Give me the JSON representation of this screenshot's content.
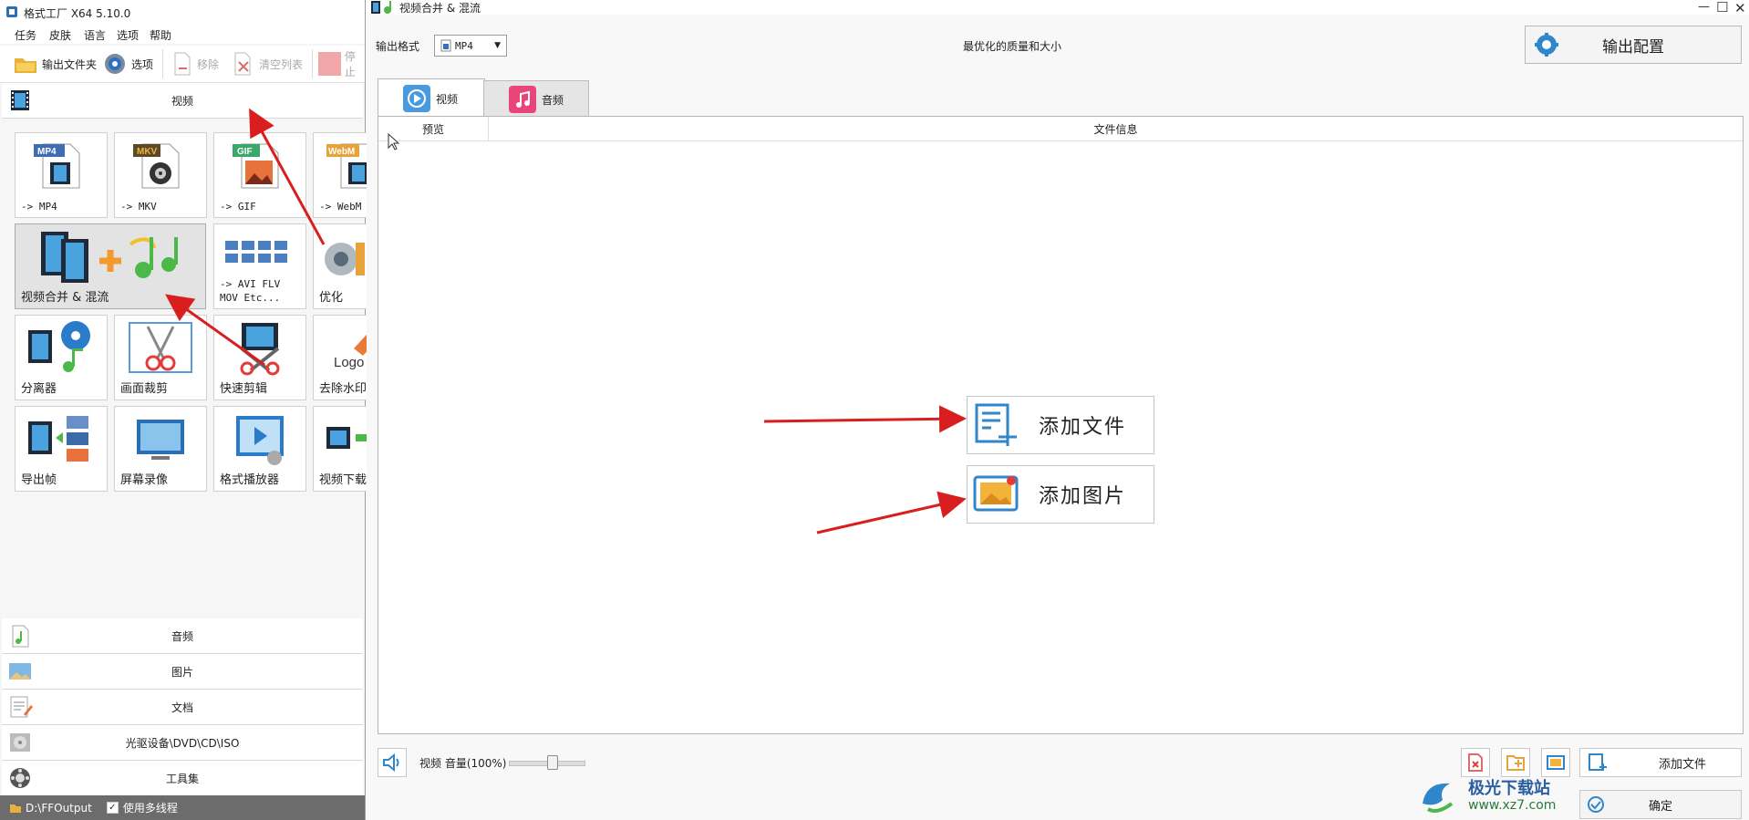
{
  "main_window": {
    "title": "格式工厂 X64 5.10.0",
    "menu": [
      "任务",
      "皮肤",
      "语言",
      "选项",
      "帮助"
    ],
    "toolbar": {
      "output_folder": "输出文件夹",
      "options": "选项",
      "remove": "移除",
      "clear_list": "清空列表",
      "stop": "停止"
    },
    "video_category": "视频",
    "tiles": [
      {
        "label": "-> MP4",
        "badge": "MP4"
      },
      {
        "label": "-> MKV",
        "badge": "MKV"
      },
      {
        "label": "-> GIF",
        "badge": "GIF"
      },
      {
        "label": "-> WebM",
        "badge": "WebM"
      },
      {
        "label": "视频合并 & 混流"
      },
      {
        "label": "-> AVI FLV\nMOV Etc..."
      },
      {
        "label": "优化"
      },
      {
        "label": "分离器"
      },
      {
        "label": "画面裁剪"
      },
      {
        "label": "快速剪辑"
      },
      {
        "label": "去除水印",
        "badge": "Logo"
      },
      {
        "label": "导出帧"
      },
      {
        "label": "屏幕录像"
      },
      {
        "label": "格式播放器"
      },
      {
        "label": "视频下载"
      }
    ],
    "categories": [
      "音频",
      "图片",
      "文档",
      "光驱设备\\DVD\\CD\\ISO",
      "工具集"
    ],
    "status": {
      "output_path": "D:\\FFOutput",
      "multithread_label": "使用多线程"
    }
  },
  "dialog": {
    "title": "视频合并 & 混流",
    "output_format_label": "输出格式",
    "output_format_value": "MP4",
    "quality_text": "最优化的质量和大小",
    "output_config_button": "输出配置",
    "tabs": [
      "视频",
      "音频"
    ],
    "table_headers": [
      "预览",
      "文件信息"
    ],
    "add_file_button": "添加文件",
    "add_image_button": "添加图片",
    "volume_label": "视频 音量(100%)",
    "volume_value": 100,
    "add_file_small": "添加文件",
    "ok_button": "确定"
  },
  "watermark": {
    "cn": "极光下载站",
    "url": "www.xz7.com"
  },
  "colors": {
    "accent_blue": "#2f86c9",
    "annotation_red": "#d81e1e",
    "music_pink": "#e8457a"
  }
}
